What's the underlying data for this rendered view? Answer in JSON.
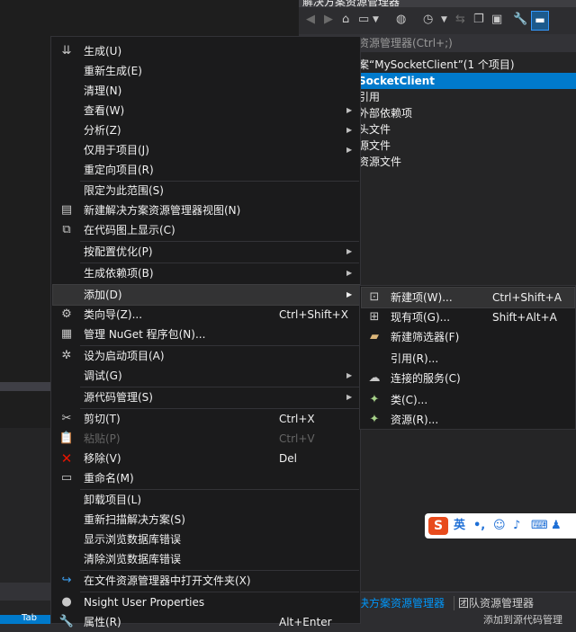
{
  "solution_explorer": {
    "title": "解决方案资源管理器",
    "search_placeholder": "资源管理器(Ctrl+;)",
    "tree": [
      {
        "label": "案“MySocketClient”(1 个项目)",
        "selected": false
      },
      {
        "label": "SocketClient",
        "selected": true
      },
      {
        "label": "引用",
        "selected": false
      },
      {
        "label": "外部依赖项",
        "selected": false
      },
      {
        "label": "头文件",
        "selected": false
      },
      {
        "label": "源文件",
        "selected": false
      },
      {
        "label": "资源文件",
        "selected": false
      }
    ],
    "tabs": [
      {
        "label": "决方案资源管理器",
        "active": true
      },
      {
        "label": "团队资源管理器",
        "active": false
      }
    ],
    "status_text": "添加到源代码管理"
  },
  "editor": {
    "status_fragment": "Tab"
  },
  "context_menu": {
    "items": [
      {
        "label": "生成(U)",
        "icon": "build-icon"
      },
      {
        "label": "重新生成(E)"
      },
      {
        "label": "清理(N)"
      },
      {
        "label": "查看(W)",
        "submenu": true
      },
      {
        "label": "分析(Z)",
        "submenu": true
      },
      {
        "label": "仅用于项目(J)",
        "submenu": true
      },
      {
        "label": "重定向项目(R)"
      },
      {
        "label": "限定为此范围(S)"
      },
      {
        "label": "新建解决方案资源管理器视图(N)",
        "icon": "new-view-icon"
      },
      {
        "label": "在代码图上显示(C)",
        "icon": "code-map-icon"
      },
      {
        "label": "按配置优化(P)",
        "submenu": true
      },
      {
        "label": "生成依赖项(B)",
        "submenu": true
      },
      {
        "label": "添加(D)",
        "submenu": true,
        "highlighted": true
      },
      {
        "label": "类向导(Z)...",
        "shortcut": "Ctrl+Shift+X",
        "icon": "class-wizard-icon"
      },
      {
        "label": "管理 NuGet 程序包(N)...",
        "icon": "nuget-icon"
      },
      {
        "label": "设为启动项目(A)",
        "icon": "gear-icon"
      },
      {
        "label": "调试(G)",
        "submenu": true
      },
      {
        "label": "源代码管理(S)",
        "submenu": true
      },
      {
        "label": "剪切(T)",
        "shortcut": "Ctrl+X",
        "icon": "scissors-icon"
      },
      {
        "label": "粘贴(P)",
        "shortcut": "Ctrl+V",
        "icon": "paste-icon",
        "disabled": true
      },
      {
        "label": "移除(V)",
        "shortcut": "Del",
        "icon": "remove-icon"
      },
      {
        "label": "重命名(M)",
        "icon": "rename-icon"
      },
      {
        "label": "卸载项目(L)"
      },
      {
        "label": "重新扫描解决方案(S)"
      },
      {
        "label": "显示浏览数据库错误"
      },
      {
        "label": "清除浏览数据库错误"
      },
      {
        "label": "在文件资源管理器中打开文件夹(X)",
        "icon": "open-folder-icon"
      },
      {
        "label": "Nsight User Properties",
        "icon": "nsight-icon"
      },
      {
        "label": "属性(R)",
        "shortcut": "Alt+Enter",
        "icon": "wrench-icon"
      }
    ]
  },
  "add_submenu": {
    "items": [
      {
        "label": "新建项(W)...",
        "shortcut": "Ctrl+Shift+A",
        "icon": "new-item-icon"
      },
      {
        "label": "现有项(G)...",
        "shortcut": "Shift+Alt+A",
        "icon": "existing-item-icon"
      },
      {
        "label": "新建筛选器(F)",
        "icon": "new-filter-icon"
      },
      {
        "label": "引用(R)..."
      },
      {
        "label": "连接的服务(C)",
        "icon": "connected-service-icon"
      },
      {
        "label": "类(C)...",
        "icon": "class-icon"
      },
      {
        "label": "资源(R)...",
        "icon": "resource-icon"
      }
    ]
  },
  "ime_toolbar": {
    "logo": "S",
    "mode": "英"
  }
}
